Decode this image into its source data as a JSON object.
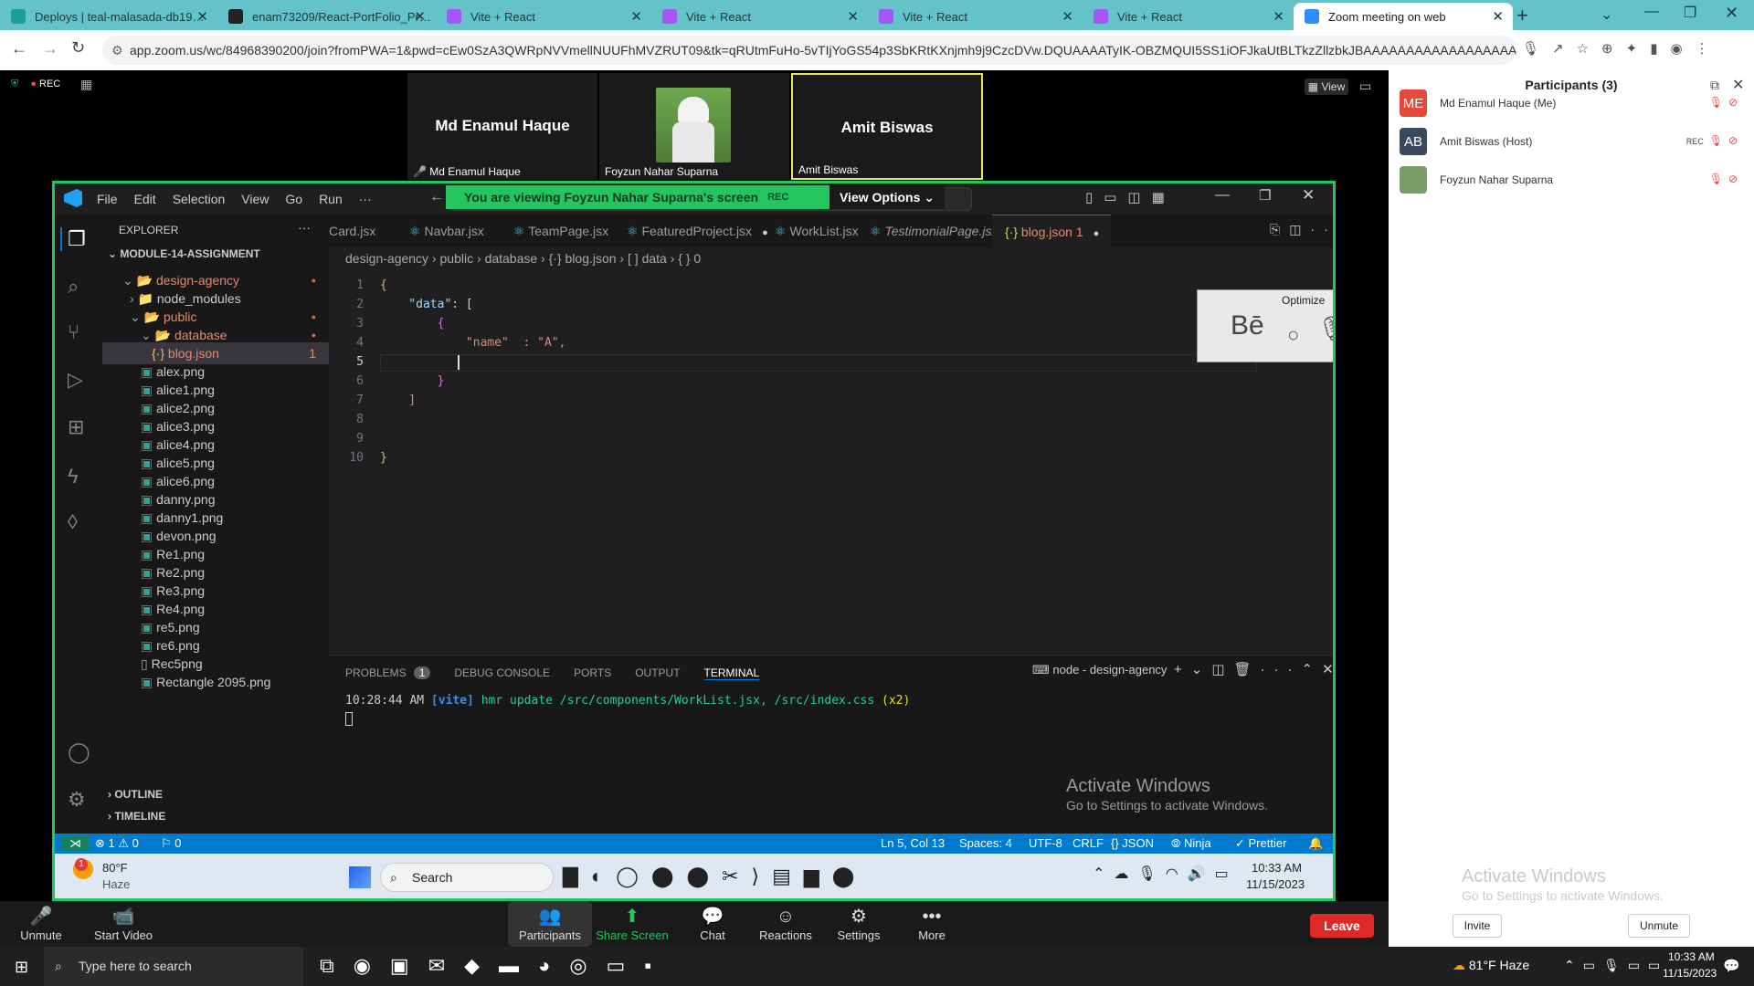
{
  "browser": {
    "tabs": [
      {
        "title": "Deploys | teal-malasada-db19…",
        "color": "#1a9e96"
      },
      {
        "title": "enam73209/React-PortFolio_Pr…",
        "color": "#222222"
      },
      {
        "title": "Vite + React",
        "color": "#a855f7"
      },
      {
        "title": "Vite + React",
        "color": "#a855f7"
      },
      {
        "title": "Vite + React",
        "color": "#a855f7"
      },
      {
        "title": "Vite + React",
        "color": "#a855f7"
      },
      {
        "title": "Zoom meeting on web",
        "color": "#2d8cff"
      }
    ],
    "url": "app.zoom.us/wc/84968390200/join?fromPWA=1&pwd=cEw0SzA3QWRpNVVmellNUUFhMVZRUT09&tk=qRUtmFuHo-5vTIjYoGS54p3SbKRtKXnjmh9j9CzcDVw.DQUAAAATyIK-OBZMQUI5SS1iOFJkaUtBLTkzZllzbkJBAAAAAAAAAAAAAAAAAAAAAA..."
  },
  "zoom": {
    "rec": "REC",
    "view": "View",
    "videos": [
      {
        "name": "Md Enamul Haque",
        "label": "Md Enamul Haque"
      },
      {
        "name": "",
        "label": "Foyzun Nahar Suparna"
      },
      {
        "name": "Amit Biswas",
        "label": "Amit Biswas"
      }
    ],
    "banner": "You are viewing  Foyzun Nahar Suparna's screen",
    "banner_rec": "REC",
    "view_options": "View Options",
    "participants_title": "Participants (3)",
    "participants": [
      {
        "initials": "ME",
        "name": "Md Enamul Haque (Me)",
        "color": "#e24a3b",
        "tag": ""
      },
      {
        "initials": "AB",
        "name": "Amit Biswas (Host)",
        "color": "#3a4a5c",
        "tag": "REC"
      },
      {
        "initials": "",
        "name": "Foyzun Nahar Suparna",
        "color": "#7a9e6a",
        "tag": ""
      }
    ],
    "watermark_title": "Activate Windows",
    "watermark_sub": "Go to Settings to activate Windows.",
    "invite": "Invite",
    "unmute_all": "Unmute",
    "controls": [
      {
        "label": "Unmute",
        "icon": "🎤"
      },
      {
        "label": "Start Video",
        "icon": "📹"
      },
      {
        "label": "Participants",
        "icon": "👥",
        "count": "3"
      },
      {
        "label": "Share Screen",
        "icon": "⬆"
      },
      {
        "label": "Chat",
        "icon": "💬"
      },
      {
        "label": "Reactions",
        "icon": "☺"
      },
      {
        "label": "Settings",
        "icon": "⚙"
      },
      {
        "label": "More",
        "icon": "•••"
      }
    ],
    "leave": "Leave"
  },
  "vscode": {
    "menu": [
      "File",
      "Edit",
      "Selection",
      "View",
      "Go",
      "Run",
      "···"
    ],
    "explorer_title": "EXPLORER",
    "project": "MODULE-14-ASSIGNMENT",
    "tree": [
      {
        "label": "design-agency",
        "indent": 1,
        "kind": "folder-open",
        "color": "#e7896a"
      },
      {
        "label": "node_modules",
        "indent": 2,
        "kind": "folder",
        "color": "#cccccc"
      },
      {
        "label": "public",
        "indent": 2,
        "kind": "folder-open",
        "color": "#e7896a"
      },
      {
        "label": "database",
        "indent": 3,
        "kind": "folder-open",
        "color": "#e7896a"
      },
      {
        "label": "blog.json",
        "indent": 4,
        "kind": "json",
        "color": "#e7896a",
        "badge": "1"
      },
      {
        "label": "alex.png",
        "indent": 3,
        "kind": "img",
        "color": "#cccccc"
      },
      {
        "label": "alice1.png",
        "indent": 3,
        "kind": "img",
        "color": "#cccccc"
      },
      {
        "label": "alice2.png",
        "indent": 3,
        "kind": "img",
        "color": "#cccccc"
      },
      {
        "label": "alice3.png",
        "indent": 3,
        "kind": "img",
        "color": "#cccccc"
      },
      {
        "label": "alice4.png",
        "indent": 3,
        "kind": "img",
        "color": "#cccccc"
      },
      {
        "label": "alice5.png",
        "indent": 3,
        "kind": "img",
        "color": "#cccccc"
      },
      {
        "label": "alice6.png",
        "indent": 3,
        "kind": "img",
        "color": "#cccccc"
      },
      {
        "label": "danny.png",
        "indent": 3,
        "kind": "img",
        "color": "#cccccc"
      },
      {
        "label": "danny1.png",
        "indent": 3,
        "kind": "img",
        "color": "#cccccc"
      },
      {
        "label": "devon.png",
        "indent": 3,
        "kind": "img",
        "color": "#cccccc"
      },
      {
        "label": "Re1.png",
        "indent": 3,
        "kind": "img",
        "color": "#cccccc"
      },
      {
        "label": "Re2.png",
        "indent": 3,
        "kind": "img",
        "color": "#cccccc"
      },
      {
        "label": "Re3.png",
        "indent": 3,
        "kind": "img",
        "color": "#cccccc"
      },
      {
        "label": "Re4.png",
        "indent": 3,
        "kind": "img",
        "color": "#cccccc"
      },
      {
        "label": "re5.png",
        "indent": 3,
        "kind": "img",
        "color": "#cccccc"
      },
      {
        "label": "re6.png",
        "indent": 3,
        "kind": "img",
        "color": "#cccccc"
      },
      {
        "label": "Rec5png",
        "indent": 3,
        "kind": "file",
        "color": "#cccccc"
      },
      {
        "label": "Rectangle 2095.png",
        "indent": 3,
        "kind": "img",
        "color": "#cccccc"
      }
    ],
    "outline": "OUTLINE",
    "timeline": "TIMELINE",
    "tabs": [
      {
        "label": "Card.jsx",
        "modified": false
      },
      {
        "label": "Navbar.jsx",
        "modified": false
      },
      {
        "label": "TeamPage.jsx",
        "modified": false
      },
      {
        "label": "FeaturedProject.jsx",
        "modified": true
      },
      {
        "label": "WorkList.jsx",
        "modified": false
      },
      {
        "label": "TestimonialPage.jsx",
        "modified": false
      },
      {
        "label": "blog.json 1",
        "modified": true
      }
    ],
    "breadcrumb": [
      "design-agency",
      "public",
      "database",
      "{·} blog.json",
      "[ ] data",
      "{ } 0"
    ],
    "code": [
      {
        "n": "1",
        "text": "{"
      },
      {
        "n": "2",
        "text": "    \"data\": ["
      },
      {
        "n": "3",
        "text": "        {"
      },
      {
        "n": "4",
        "text": "            \"name\"  : \"A\","
      },
      {
        "n": "5",
        "text": ""
      },
      {
        "n": "6",
        "text": "        }"
      },
      {
        "n": "7",
        "text": "    ]"
      },
      {
        "n": "8",
        "text": ""
      },
      {
        "n": "9",
        "text": ""
      },
      {
        "n": "10",
        "text": "}"
      }
    ],
    "overlay_label": "Optimize",
    "panel_tabs": [
      "PROBLEMS",
      "DEBUG CONSOLE",
      "PORTS",
      "OUTPUT",
      "TERMINAL"
    ],
    "problems_count": "1",
    "terminal_name": "node - design-agency",
    "terminal_line_time": "10:28:44 AM",
    "terminal_line_tag": "[vite]",
    "terminal_line_msg": "hmr update /src/components/WorkList.jsx, /src/index.css",
    "terminal_line_x": "(x2)",
    "status": {
      "errors": "⊗ 1 ⚠ 0",
      "ports": "⚐ 0",
      "position": "Ln 5, Col 13",
      "spaces": "Spaces: 4",
      "encoding": "UTF-8",
      "eol": "CRLF",
      "lang": "{} JSON",
      "ninja": "Ninja",
      "prettier": "✓ Prettier"
    },
    "win_watermark_title": "Activate Windows",
    "win_watermark_sub": "Go to Settings to activate Windows.",
    "inner_taskbar": {
      "temp": "80°F",
      "weather": "Haze",
      "search": "Search",
      "time": "10:33 AM",
      "date": "11/15/2023"
    }
  },
  "taskbar": {
    "search": "Type here to search",
    "weather": "81°F  Haze",
    "time": "10:33 AM",
    "date": "11/15/2023"
  }
}
